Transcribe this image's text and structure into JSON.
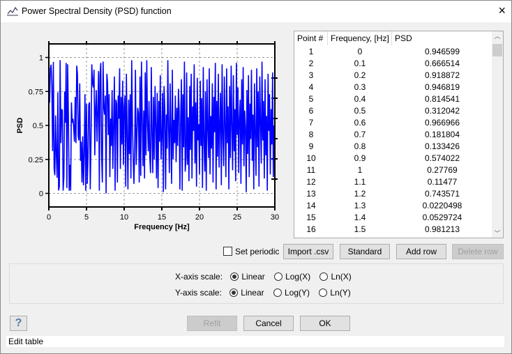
{
  "window": {
    "title": "Power Spectral Density (PSD) function",
    "icon": "chart-icon",
    "close": "×"
  },
  "table": {
    "headers": [
      "Point #",
      "Frequency, [Hz]",
      "PSD"
    ],
    "rows": [
      [
        "1",
        "0",
        "0.946599"
      ],
      [
        "2",
        "0.1",
        "0.666514"
      ],
      [
        "3",
        "0.2",
        "0.918872"
      ],
      [
        "4",
        "0.3",
        "0.946819"
      ],
      [
        "5",
        "0.4",
        "0.814541"
      ],
      [
        "6",
        "0.5",
        "0.312042"
      ],
      [
        "7",
        "0.6",
        "0.966966"
      ],
      [
        "8",
        "0.7",
        "0.181804"
      ],
      [
        "9",
        "0.8",
        "0.133426"
      ],
      [
        "10",
        "0.9",
        "0.574022"
      ],
      [
        "11",
        "1",
        "0.27769"
      ],
      [
        "12",
        "1.1",
        "0.11477"
      ],
      [
        "13",
        "1.2",
        "0.743571"
      ],
      [
        "14",
        "1.3",
        "0.0220498"
      ],
      [
        "15",
        "1.4",
        "0.0529724"
      ],
      [
        "16",
        "1.5",
        "0.981213"
      ]
    ]
  },
  "buttons": {
    "set_periodic": "Set periodic",
    "import": "Import .csv",
    "standard": "Standard",
    "add_row": "Add row",
    "delete_row": "Delete row",
    "refit": "Refit",
    "cancel": "Cancel",
    "ok": "OK",
    "help": "?"
  },
  "scales": {
    "x_label": "X-axis scale:",
    "y_label": "Y-axis scale:",
    "x_options": [
      "Linear",
      "Log(X)",
      "Ln(X)"
    ],
    "y_options": [
      "Linear",
      "Log(Y)",
      "Ln(Y)"
    ],
    "x_selected": "Linear",
    "y_selected": "Linear"
  },
  "status": "Edit table",
  "chart_data": {
    "type": "line",
    "xlabel": "Frequency [Hz]",
    "ylabel": "PSD",
    "xlim": [
      0,
      30
    ],
    "ylim": [
      -0.1,
      1.1
    ],
    "xticks": [
      "0",
      "5",
      "10",
      "15",
      "20",
      "25",
      "30"
    ],
    "yticks": [
      "0",
      "0.25",
      "0.5",
      "0.75",
      "1"
    ],
    "grid": true,
    "color": "#0000ff",
    "x_start": 0,
    "x_step": 0.1,
    "values": [
      0.946599,
      0.666514,
      0.918872,
      0.946819,
      0.814541,
      0.312042,
      0.966966,
      0.181804,
      0.133426,
      0.574022,
      0.27769,
      0.11477,
      0.743571,
      0.02205,
      0.05297,
      0.981213,
      0.37,
      0.62,
      0.61,
      0.02,
      0.12,
      0.75,
      0.52,
      0.96,
      0.04,
      0.95,
      0.55,
      0.02,
      0.21,
      0.02,
      0.67,
      0.52,
      0.55,
      0.49,
      0.38,
      0.71,
      0.37,
      0.94,
      0.88,
      0.42,
      0.39,
      0.81,
      0.24,
      0.38,
      0.08,
      0.42,
      0.06,
      0.31,
      0.73,
      0.02,
      0.66,
      0.07,
      0.27,
      0.65,
      0.67,
      0.03,
      0.39,
      0.95,
      0.82,
      0.78,
      0.91,
      0.28,
      0.63,
      0.76,
      0.38,
      0.61,
      0.9,
      0.02,
      0.87,
      0.96,
      0.29,
      0.08,
      0.97,
      0.64,
      0.58,
      0.72,
      0.0,
      0.88,
      0.81,
      0.43,
      0.73,
      0.12,
      0.55,
      0.35,
      0.76,
      0.18,
      0.51,
      0.86,
      0.02,
      0.69,
      0.66,
      0.08,
      0.72,
      0.55,
      0.92,
      0.18,
      0.71,
      0.36,
      0.83,
      0.21,
      0.64,
      0.72,
      0.05,
      0.88,
      0.44,
      0.03,
      0.69,
      0.29,
      0.73,
      0.11,
      0.98,
      0.5,
      0.24,
      0.07,
      0.33,
      0.91,
      0.21,
      0.44,
      0.63,
      0.59,
      0.08,
      0.86,
      0.13,
      0.97,
      0.56,
      0.2,
      0.61,
      0.11,
      0.89,
      0.28,
      0.98,
      0.52,
      0.31,
      0.68,
      0.27,
      0.15,
      0.93,
      0.43,
      0.15,
      0.71,
      0.25,
      0.79,
      0.49,
      0.11,
      0.74,
      0.04,
      0.68,
      0.38,
      0.87,
      0.25,
      0.42,
      0.74,
      0.01,
      0.79,
      0.62,
      0.03,
      0.58,
      0.33,
      0.98,
      0.49,
      0.15,
      0.81,
      0.44,
      0.07,
      0.91,
      0.25,
      0.54,
      0.37,
      0.72,
      0.23,
      0.63,
      0.35,
      0.77,
      0.61,
      0.03,
      0.55,
      0.84,
      0.02,
      0.73,
      0.34,
      0.97,
      0.16,
      0.26,
      0.89,
      0.21,
      0.56,
      0.09,
      0.79,
      0.32,
      0.88,
      0.11,
      0.64,
      0.46,
      0.95,
      0.22,
      0.67,
      0.05,
      0.85,
      0.39,
      0.51,
      0.14,
      0.83,
      0.35,
      0.7,
      0.04,
      0.93,
      0.38,
      0.16,
      0.75,
      0.02,
      0.84,
      0.47,
      0.26,
      0.92,
      0.14,
      0.57,
      0.33,
      0.81,
      0.08,
      0.71,
      0.45,
      0.96,
      0.03,
      0.68,
      0.27,
      0.88,
      0.19,
      0.53,
      0.74,
      0.06,
      0.95,
      0.41,
      0.2,
      0.86,
      0.51,
      0.12,
      0.92,
      0.37,
      0.64,
      0.03,
      0.79,
      0.26,
      0.94,
      0.5,
      0.17,
      0.87,
      0.31,
      0.62,
      0.09,
      0.96,
      0.43,
      0.78,
      0.15,
      0.55,
      0.69,
      0.07,
      0.84,
      0.36,
      0.93,
      0.2,
      0.61,
      0.48,
      0.01,
      0.76,
      0.29,
      0.87,
      0.12,
      0.66,
      0.4,
      0.91,
      0.24,
      0.58,
      0.03,
      0.81,
      0.45,
      0.13,
      0.92,
      0.34,
      0.75,
      0.05,
      0.86,
      0.52,
      0.22,
      0.97,
      0.39,
      0.68,
      0.11,
      0.84,
      0.28,
      0.57,
      0.02,
      0.88,
      0.46,
      0.73,
      0.14,
      0.62,
      0.36,
      0.89,
      0.12,
      0.5
    ]
  }
}
